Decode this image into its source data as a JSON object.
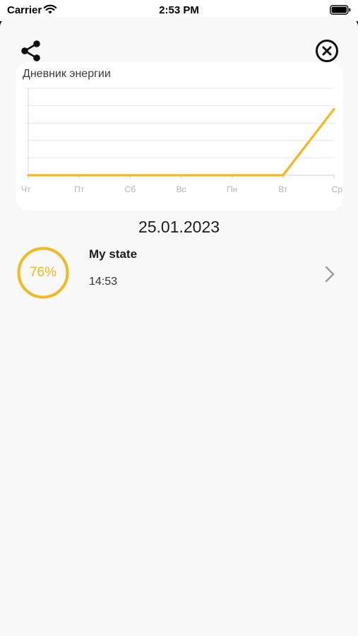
{
  "status_bar": {
    "carrier": "Carrier",
    "time": "2:53 PM"
  },
  "header": {
    "share_icon": "share-icon",
    "close_icon": "close-circle-icon"
  },
  "chart_data": {
    "type": "line",
    "title": "Дневник энергии",
    "categories": [
      "Чт",
      "Пт",
      "Сб",
      "Вс",
      "Пн",
      "Вт",
      "Ср"
    ],
    "values": [
      0,
      0,
      0,
      0,
      0,
      0,
      76
    ],
    "ylim": [
      0,
      100
    ],
    "grid": true,
    "color": "#f2b81f"
  },
  "day": {
    "date": "25.01.2023"
  },
  "entry": {
    "value_text": "76%",
    "value": 0.76,
    "title": "My state",
    "time": "14:53",
    "accent": "#f2b81f"
  }
}
